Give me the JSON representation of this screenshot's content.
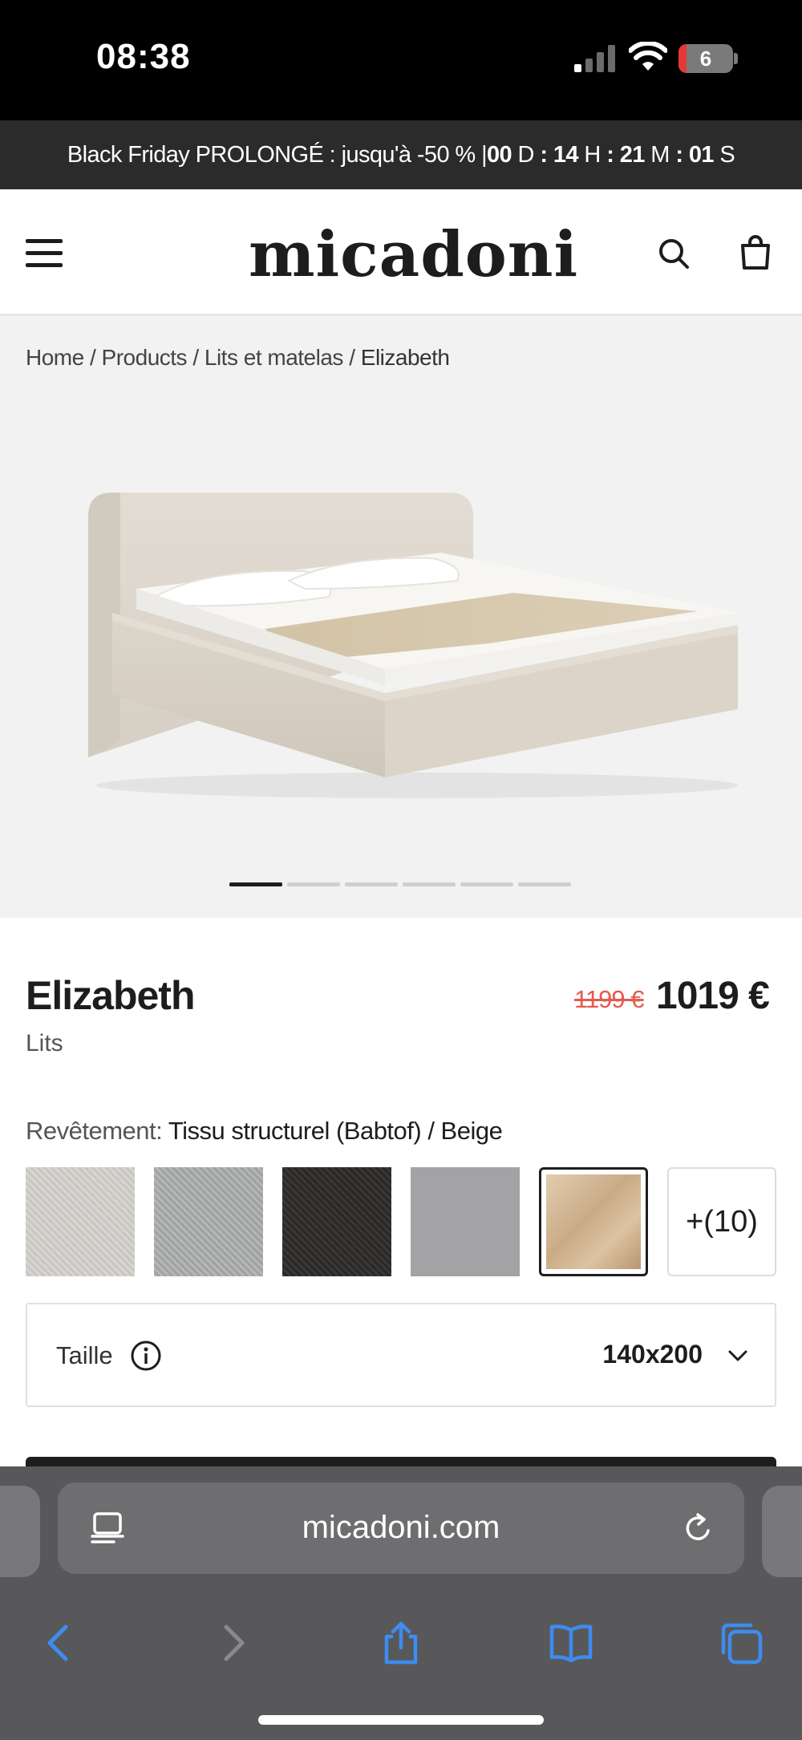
{
  "status_bar": {
    "time": "08:38",
    "battery_level": "6"
  },
  "promo": {
    "text_prefix": "Black Friday PROLONGÉ : jusqu'à -50 % |",
    "days": "00",
    "days_unit": "D",
    "hours": "14",
    "hours_unit": "H",
    "minutes": "21",
    "minutes_unit": "M",
    "seconds": "01",
    "seconds_unit": "S",
    "separator": ":"
  },
  "header": {
    "logo": "micadoni"
  },
  "breadcrumb": {
    "home": "Home",
    "products": "Products",
    "category": "Lits et matelas",
    "current": "Elizabeth",
    "separator": "/"
  },
  "gallery": {
    "slide_count": 6,
    "active_slide": 1
  },
  "product": {
    "title": "Elizabeth",
    "category": "Lits",
    "price_old": "1199 €",
    "price_new": "1019 €"
  },
  "covering": {
    "label": "Revêtement:",
    "value": "Tissu structurel (Babtof) / Beige",
    "more_label": "+(10)",
    "swatch_colors": [
      "#d0cec9",
      "#aaadac",
      "#322f2d",
      "#a3a3a5",
      "#d4b895"
    ],
    "selected_index": 4
  },
  "size": {
    "label": "Taille",
    "value": "140x200"
  },
  "browser": {
    "url": "micadoni.com"
  },
  "colors": {
    "promo_bg": "#2b2b2b",
    "price_old": "#e35b4f",
    "ios_blue": "#3d8cf0",
    "safari_bg": "#58585a"
  }
}
